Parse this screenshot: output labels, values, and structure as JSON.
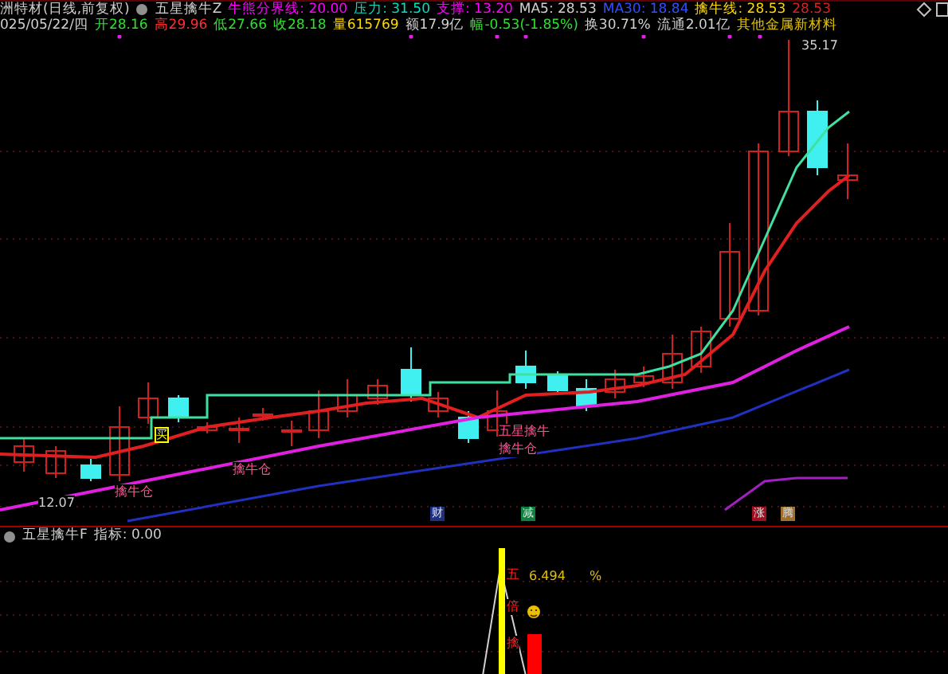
{
  "header": {
    "title": "洲特材(日线,前复权)",
    "indicator": "五星擒牛Z",
    "values": [
      {
        "text": "牛熊分界线: 20.00",
        "color": "#ff00ff"
      },
      {
        "text": "压力: 31.50",
        "color": "#00e0c0"
      },
      {
        "text": "支撑: 13.20",
        "color": "#ff00ff"
      },
      {
        "text": "MA5: 28.53",
        "color": "#d0d0d0"
      },
      {
        "text": "MA30: 18.84",
        "color": "#3050ff"
      },
      {
        "text": "擒牛线: 28.53",
        "color": "#ffd800"
      },
      {
        "text": "28.53",
        "color": "#e02020"
      }
    ]
  },
  "quote": [
    {
      "text": "025/05/22/四",
      "color": "#d0d0d0"
    },
    {
      "text": "开28.16",
      "color": "#30e030"
    },
    {
      "text": "高29.96",
      "color": "#ff3030"
    },
    {
      "text": "低27.66",
      "color": "#30e030"
    },
    {
      "text": "收28.18",
      "color": "#30e030"
    },
    {
      "text": "量615769",
      "color": "#ffd800"
    },
    {
      "text": "额17.9亿",
      "color": "#d0d0d0"
    },
    {
      "text": "幅-0.53(-1.85%)",
      "color": "#30e030"
    },
    {
      "text": "换30.71%",
      "color": "#d0d0d0"
    },
    {
      "text": "流通2.01亿",
      "color": "#d0d0d0"
    },
    {
      "text": "其他金属新材料",
      "color": "#e0c000"
    }
  ],
  "chart_labels": [
    {
      "text": "35.17",
      "kind": "price"
    },
    {
      "text": "12.07",
      "kind": "price"
    },
    {
      "text": "擒牛仓",
      "kind": "signal"
    },
    {
      "text": "擒牛仓",
      "kind": "signal"
    },
    {
      "text": "五星擒牛",
      "kind": "signal"
    },
    {
      "text": "擒牛仓",
      "kind": "signal"
    },
    {
      "text": "买",
      "kind": "buy"
    }
  ],
  "markers": [
    {
      "text": "财",
      "color": "#203080"
    },
    {
      "text": "减",
      "color": "#108040"
    },
    {
      "text": "涨",
      "color": "#a01020"
    },
    {
      "text": "腾",
      "color": "#a07030"
    }
  ],
  "lower": {
    "indicator": "五星擒牛F",
    "reading": "指标: 0.00",
    "value": "6.494",
    "unit": "%",
    "vertical": [
      "五",
      "倍",
      "擒"
    ]
  }
}
